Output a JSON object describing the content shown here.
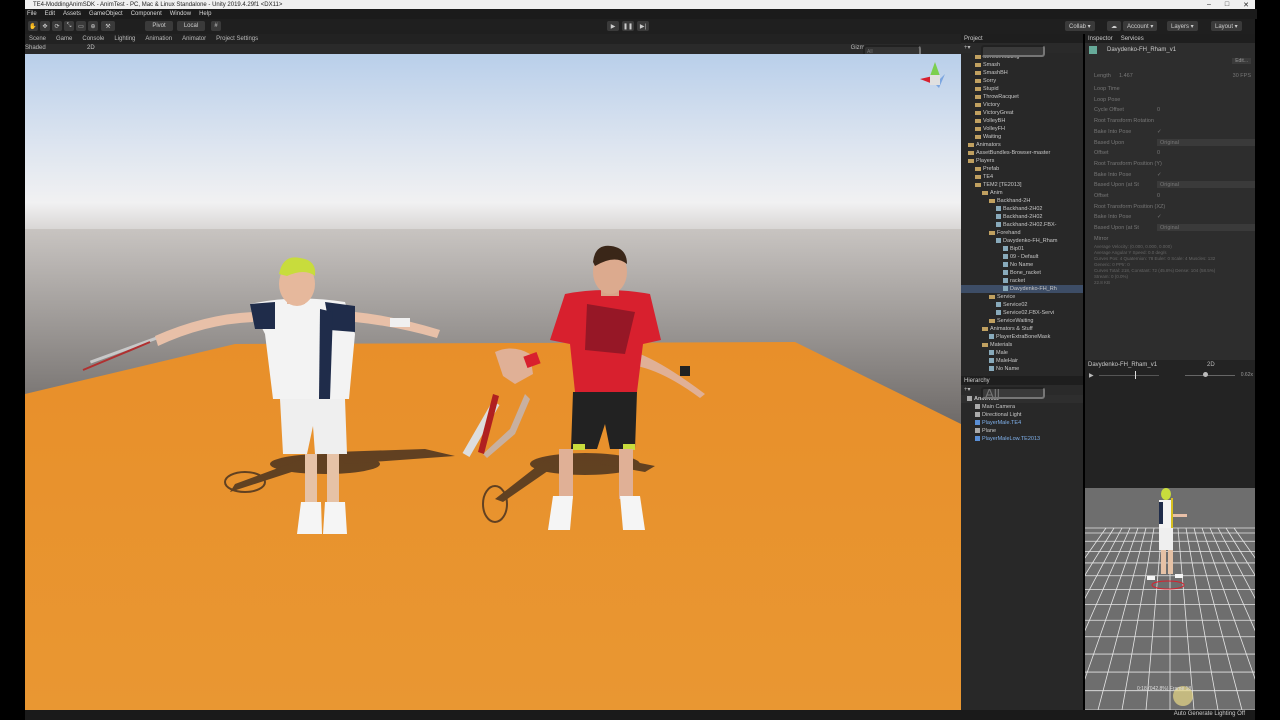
{
  "title_bar": {
    "text": "TE4-ModdingAnimSDK - AnimTest - PC, Mac & Linux Standalone - Unity 2019.4.29f1 <DX11>",
    "controls": [
      "–",
      "□",
      "✕"
    ]
  },
  "menu": [
    "File",
    "Edit",
    "Assets",
    "GameObject",
    "Component",
    "Window",
    "Help"
  ],
  "toolbar": {
    "pivot": "Pivot",
    "local": "Local",
    "collab": "Collab ▾",
    "account": "Account ▾",
    "layers": "Layers ▾",
    "layout": "Layout ▾",
    "play_icons": [
      "play-icon",
      "pause-icon",
      "step-icon"
    ]
  },
  "scene_tabs": [
    "Scene",
    "Game",
    "Console",
    "Lighting",
    "Animation",
    "Animator",
    "Project Settings"
  ],
  "scene_bar": {
    "shading": "Shaded",
    "mode": "2D",
    "gizmos": "Gizmos",
    "search_placeholder": "All"
  },
  "project": {
    "tabs": [
      "Project"
    ],
    "items": [
      {
        "label": "ServiceWaiting",
        "depth": 2,
        "type": "folder"
      },
      {
        "label": "Smash",
        "depth": 2,
        "type": "folder"
      },
      {
        "label": "SmashBH",
        "depth": 2,
        "type": "folder"
      },
      {
        "label": "Sorry",
        "depth": 2,
        "type": "folder"
      },
      {
        "label": "Stupid",
        "depth": 2,
        "type": "folder"
      },
      {
        "label": "ThrowRacquet",
        "depth": 2,
        "type": "folder"
      },
      {
        "label": "Victory",
        "depth": 2,
        "type": "folder"
      },
      {
        "label": "VictoryGreat",
        "depth": 2,
        "type": "folder"
      },
      {
        "label": "VolleyBH",
        "depth": 2,
        "type": "folder"
      },
      {
        "label": "VolleyFH",
        "depth": 2,
        "type": "folder"
      },
      {
        "label": "Waiting",
        "depth": 2,
        "type": "folder"
      },
      {
        "label": "Animators",
        "depth": 1,
        "type": "folder"
      },
      {
        "label": "AssetBundles-Browser-master",
        "depth": 1,
        "type": "folder"
      },
      {
        "label": "Players",
        "depth": 1,
        "type": "folder"
      },
      {
        "label": "Prefab",
        "depth": 2,
        "type": "folder"
      },
      {
        "label": "TE4",
        "depth": 2,
        "type": "folder"
      },
      {
        "label": "TEM2 [TE2013]",
        "depth": 2,
        "type": "folder"
      },
      {
        "label": "Anim",
        "depth": 3,
        "type": "folder"
      },
      {
        "label": "Backhand-2H",
        "depth": 4,
        "type": "folder"
      },
      {
        "label": "Backhand-2H02",
        "depth": 5,
        "type": "asset"
      },
      {
        "label": "Backhand-2H02",
        "depth": 5,
        "type": "asset"
      },
      {
        "label": "Backhand-2H02.FBX-",
        "depth": 5,
        "type": "asset"
      },
      {
        "label": "Forehand",
        "depth": 4,
        "type": "folder"
      },
      {
        "label": "Davydenko-FH_Rham",
        "depth": 5,
        "type": "asset"
      },
      {
        "label": "Bip01",
        "depth": 6,
        "type": "asset"
      },
      {
        "label": "09 - Default",
        "depth": 6,
        "type": "asset"
      },
      {
        "label": "No Name",
        "depth": 6,
        "type": "asset"
      },
      {
        "label": "Bone_racket",
        "depth": 6,
        "type": "asset"
      },
      {
        "label": "racket",
        "depth": 6,
        "type": "asset"
      },
      {
        "label": "Davydenko-FH_Rh",
        "depth": 6,
        "type": "asset",
        "selected": true
      },
      {
        "label": "Service",
        "depth": 4,
        "type": "folder"
      },
      {
        "label": "Service02",
        "depth": 5,
        "type": "asset"
      },
      {
        "label": "Service02.FBX-Servi",
        "depth": 5,
        "type": "asset"
      },
      {
        "label": "ServiceWaiting",
        "depth": 4,
        "type": "folder"
      },
      {
        "label": "Animators & Stuff",
        "depth": 3,
        "type": "folder"
      },
      {
        "label": "PlayerExtraBoneMask",
        "depth": 4,
        "type": "asset"
      },
      {
        "label": "Materials",
        "depth": 3,
        "type": "folder"
      },
      {
        "label": "Male",
        "depth": 4,
        "type": "asset"
      },
      {
        "label": "MaleHair",
        "depth": 4,
        "type": "asset"
      },
      {
        "label": "No Name",
        "depth": 4,
        "type": "asset"
      }
    ]
  },
  "hierarchy": {
    "tab": "Hierarchy",
    "search_placeholder": "All",
    "items": [
      {
        "label": "AnimTest",
        "depth": 0,
        "bold": true
      },
      {
        "label": "Main Camera",
        "depth": 1
      },
      {
        "label": "Directional Light",
        "depth": 1
      },
      {
        "label": "PlayerMale.TE4",
        "depth": 1,
        "prefab": true
      },
      {
        "label": "Plane",
        "depth": 1
      },
      {
        "label": "PlayerMaleLow.TE2013",
        "depth": 1,
        "prefab": true
      }
    ]
  },
  "inspector": {
    "tabs": [
      "Inspector",
      "Services"
    ],
    "object_name": "Davydenko-FH_Rham_v1",
    "edit_button": "Edit...",
    "length_label": "Length",
    "length_value": "1.467",
    "fps_value": "30 FPS",
    "rows": [
      {
        "label": "Loop Time",
        "value": ""
      },
      {
        "label": "Loop Pose",
        "value": ""
      },
      {
        "label": "Cycle Offset",
        "value": "0"
      },
      {
        "label": "Root Transform Rotation",
        "value": ""
      },
      {
        "label": "Bake Into Pose",
        "value": "✓"
      },
      {
        "label": "Based Upon",
        "value": "Original"
      },
      {
        "label": "Offset",
        "value": "0"
      },
      {
        "label": "Root Transform Position (Y)",
        "value": ""
      },
      {
        "label": "Bake Into Pose",
        "value": "✓"
      },
      {
        "label": "Based Upon (at St",
        "value": "Original"
      },
      {
        "label": "Offset",
        "value": "0"
      },
      {
        "label": "Root Transform Position (XZ)",
        "value": ""
      },
      {
        "label": "Bake Into Pose",
        "value": "✓"
      },
      {
        "label": "Based Upon (at St",
        "value": "Original"
      },
      {
        "label": "Mirror",
        "value": ""
      }
    ],
    "info_lines": [
      "Average Velocity: (0.000, 0.000, 0.000)",
      "Average Angular Y Speed: 0.0 deg/s",
      "Curves Pos: 4 Quaternion: 78 Euler: 0 Scale: 4 Muscles: 132",
      "Generic: 0 PPtr: 0",
      "Curves Total: 218, Constant: 72 (45.8%) Dense: 104 (58.5%)",
      "Stream: 0 (0.0%)",
      "22.8 KB"
    ]
  },
  "anim_preview": {
    "name": "Davydenko-FH_Rham_v1",
    "speed_value": "2D",
    "speed_readout": "0.62x",
    "time_readout": "0:18 (042.8%) Frame 18"
  },
  "status": {
    "right": "Auto Generate Lighting Off"
  },
  "colors": {
    "sky_top": "#c8d7ea",
    "sky_horizon": "#e6e9ef",
    "ground": "#e8932e",
    "distant_plane": "#6e6a68",
    "selection": "#3d4d66",
    "shirt_red": "#d8202e",
    "shirt_navy": "#1f2c4a",
    "hair_yellow": "#c8dc3c"
  }
}
